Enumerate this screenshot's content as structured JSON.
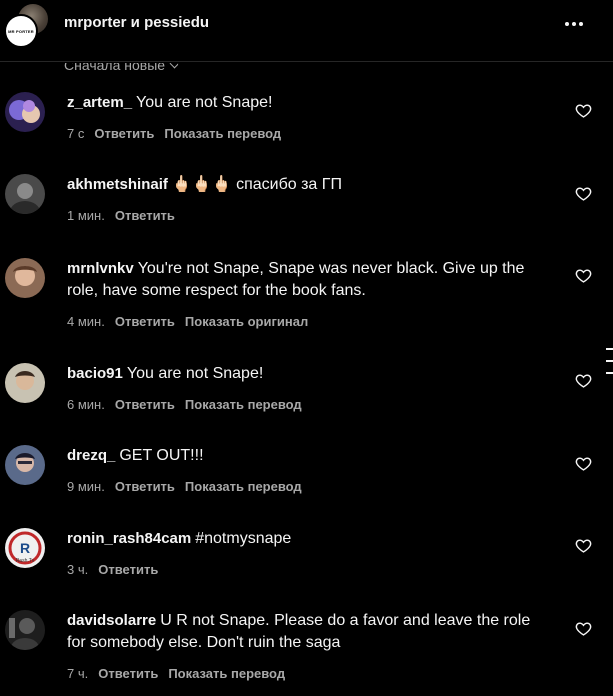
{
  "header": {
    "title": "mrporter и pessiedu",
    "front_avatar_text": "MR PORTER",
    "more_icon": "more-horizontal-icon"
  },
  "sort": {
    "label": "Сначала новые"
  },
  "comments": [
    {
      "username": "z_artem_",
      "text": "You are not Snape!",
      "time": "7 с",
      "reply": "Ответить",
      "extra": "Показать перевод",
      "avatar_color": "#6a5acd"
    },
    {
      "username": "akhmetshinaif",
      "text": "🖕🏻🖕🏻🖕🏻 спасибо за ГП",
      "time": "1 мин.",
      "reply": "Ответить",
      "extra": "",
      "avatar_color": "#5a5a5a"
    },
    {
      "username": "mrnlvnkv",
      "text": "You're not Snape, Snape was never black. Give up the role, have some respect for the book fans.",
      "time": "4 мин.",
      "reply": "Ответить",
      "extra": "Показать оригинал",
      "avatar_color": "#c9a48a"
    },
    {
      "username": "bacio91",
      "text": "You are not Snape!",
      "time": "6 мин.",
      "reply": "Ответить",
      "extra": "Показать перевод",
      "avatar_color": "#b8b0a0"
    },
    {
      "username": "drezq_",
      "text": "GET OUT!!!",
      "time": "9 мин.",
      "reply": "Ответить",
      "extra": "Показать перевод",
      "avatar_color": "#4a5a7a"
    },
    {
      "username": "ronin_rash84cam",
      "text": "#notmysnape",
      "time": "3 ч.",
      "reply": "Ответить",
      "extra": "",
      "avatar_color": "#e8e8e8",
      "avatar_text": "Rash.Tv"
    },
    {
      "username": "davidsolarre",
      "text": "U R not Snape. Please do a favor and leave the role for somebody else. Don't ruin the saga",
      "time": "7 ч.",
      "reply": "Ответить",
      "extra": "Показать перевод",
      "avatar_color": "#3a3a3a"
    }
  ]
}
